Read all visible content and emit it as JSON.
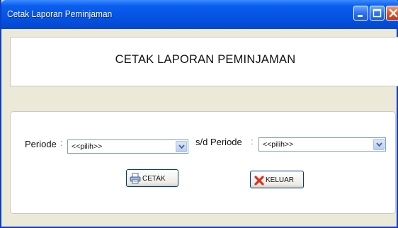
{
  "window": {
    "title": "Cetak Laporan Peminjaman"
  },
  "header": {
    "title": "CETAK LAPORAN PEMINJAMAN"
  },
  "form": {
    "start_label": "Periode",
    "start_colon": ":",
    "start_select_value": "<<pilih>>",
    "end_label": "s/d Periode",
    "end_colon": ":",
    "end_select_value": "<<pilih>>"
  },
  "buttons": {
    "print_label": "CETAK",
    "exit_label": "KELUAR"
  },
  "icons": {
    "print": "printer-icon",
    "exit": "red-x-icon",
    "minimize": "minimize-icon",
    "maximize": "maximize-icon",
    "close": "close-icon"
  },
  "colors": {
    "titlebar": "#0553e2",
    "close_button": "#e0522a",
    "panel_background": "#ece9d8"
  }
}
